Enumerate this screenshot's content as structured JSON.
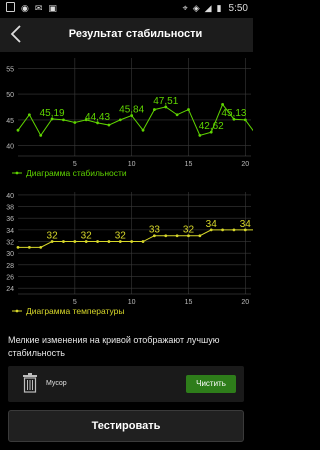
{
  "status_bar": {
    "time": "5:50",
    "icons": [
      "notification-icon",
      "whatsapp-icon",
      "gmail-icon",
      "bag-icon",
      "location-icon",
      "wifi-icon",
      "signal-icon",
      "battery-icon"
    ]
  },
  "header": {
    "title": "Результат стабильности",
    "back_icon": "back-chevron-icon"
  },
  "colors": {
    "stability_line": "#5fd400",
    "temperature_line": "#d8d82a",
    "clean_button": "#2e7d1a"
  },
  "chart_data": [
    {
      "type": "line",
      "legend": "Диаграмма стабильности",
      "legend_placement": "bottom-left",
      "grid": true,
      "ylim": [
        38,
        57
      ],
      "yticks": [
        40,
        45,
        50,
        55
      ],
      "xlim": [
        0,
        20.5
      ],
      "xticks": [
        5,
        10,
        15,
        20
      ],
      "x": [
        0,
        1,
        2,
        3,
        4,
        5,
        6,
        7,
        8,
        9,
        10,
        11,
        12,
        13,
        14,
        15,
        16,
        17,
        18,
        19,
        20,
        21
      ],
      "values": [
        43,
        46,
        42,
        45.19,
        45,
        44.5,
        45,
        44.43,
        44,
        45,
        45.84,
        43,
        47,
        47.51,
        46,
        47,
        42,
        42.62,
        48,
        45.13,
        45,
        42
      ],
      "point_labels": [
        {
          "x": 3,
          "text": "45,19"
        },
        {
          "x": 7,
          "text": "44,43"
        },
        {
          "x": 10,
          "text": "45,84"
        },
        {
          "x": 13,
          "text": "47,51"
        },
        {
          "x": 17,
          "text": "42,62"
        },
        {
          "x": 19,
          "text": "45,13"
        }
      ]
    },
    {
      "type": "line",
      "legend": "Диаграмма температуры",
      "legend_placement": "bottom-left",
      "grid": true,
      "ylim": [
        23,
        40.5
      ],
      "yticks": [
        24,
        26,
        28,
        30,
        32,
        34,
        36,
        38,
        40
      ],
      "xlim": [
        0,
        20.5
      ],
      "xticks": [
        5,
        10,
        15,
        20
      ],
      "x": [
        0,
        1,
        2,
        3,
        4,
        5,
        6,
        7,
        8,
        9,
        10,
        11,
        12,
        13,
        14,
        15,
        16,
        17,
        18,
        19,
        20,
        21
      ],
      "values": [
        31,
        31,
        31,
        32,
        32,
        32,
        32,
        32,
        32,
        32,
        32,
        32,
        33,
        33,
        33,
        33,
        33,
        34,
        34,
        34,
        34,
        34
      ],
      "point_labels": [
        {
          "x": 3,
          "text": "32"
        },
        {
          "x": 6,
          "text": "32"
        },
        {
          "x": 9,
          "text": "32"
        },
        {
          "x": 12,
          "text": "33"
        },
        {
          "x": 15,
          "text": "32"
        },
        {
          "x": 17,
          "text": "34"
        },
        {
          "x": 20,
          "text": "34"
        }
      ]
    }
  ],
  "note": "Мелкие изменения на кривой отображают лучшую стабильность",
  "trash": {
    "label": "Мусор",
    "icon": "trash-icon",
    "button": "Чистить"
  },
  "test_button": "Тестировать"
}
